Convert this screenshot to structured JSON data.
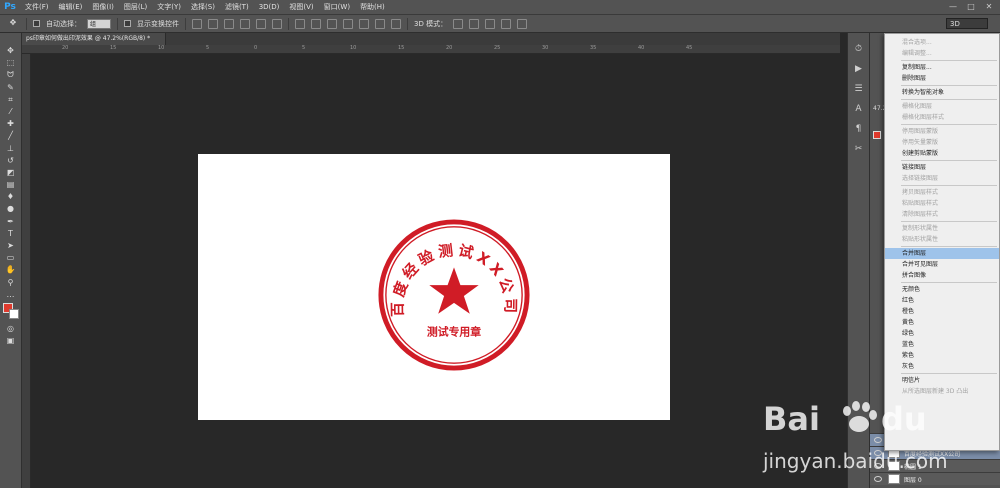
{
  "app": {
    "logo": "Ps"
  },
  "menubar": {
    "items": [
      "文件(F)",
      "编辑(E)",
      "图像(I)",
      "图层(L)",
      "文字(Y)",
      "选择(S)",
      "滤镜(T)",
      "3D(D)",
      "视图(V)",
      "窗口(W)",
      "帮助(H)"
    ],
    "window_buttons": [
      "—",
      "□",
      "✕"
    ]
  },
  "optionsbar": {
    "auto_select_label": "自动选择：",
    "auto_select_value": "组",
    "show_transform_label": "显示变换控件",
    "mode_3d_label": "3D 模式：",
    "workspace": "3D"
  },
  "document": {
    "tab_title": "ps印章如何做出印泥效果 @ 47.2%(RGB/8) *"
  },
  "ruler": {
    "top_ticks": [
      "20",
      "15",
      "10",
      "5",
      "0",
      "5",
      "10",
      "15",
      "20",
      "25",
      "30",
      "35",
      "40",
      "45"
    ]
  },
  "seal": {
    "arc_text": "百度经验测试XX公司",
    "bottom_text": "测试专用章",
    "color": "#d01c26"
  },
  "panels": {
    "zoom_readout": "47.24",
    "layers": [
      {
        "name": "★"
      },
      {
        "name": "百度经验测试XX公司"
      },
      {
        "name": "椭圆 1"
      },
      {
        "name": "图层 0"
      }
    ]
  },
  "context_menu": {
    "items": [
      {
        "label": "混合选项...",
        "enabled": false,
        "sep_after": false
      },
      {
        "label": "编辑调整...",
        "enabled": false,
        "sep_after": true
      },
      {
        "label": "复制图层...",
        "enabled": true,
        "sep_after": false
      },
      {
        "label": "删除图层",
        "enabled": true,
        "sep_after": true
      },
      {
        "label": "转换为智能对象",
        "enabled": true,
        "sep_after": true
      },
      {
        "label": "栅格化图层",
        "enabled": false,
        "sep_after": false
      },
      {
        "label": "栅格化图层样式",
        "enabled": false,
        "sep_after": true
      },
      {
        "label": "停用图层蒙版",
        "enabled": false,
        "sep_after": false
      },
      {
        "label": "停用矢量蒙版",
        "enabled": false,
        "sep_after": false
      },
      {
        "label": "创建剪贴蒙版",
        "enabled": true,
        "sep_after": true
      },
      {
        "label": "链接图层",
        "enabled": true,
        "sep_after": false
      },
      {
        "label": "选择链接图层",
        "enabled": false,
        "sep_after": true
      },
      {
        "label": "拷贝图层样式",
        "enabled": false,
        "sep_after": false
      },
      {
        "label": "粘贴图层样式",
        "enabled": false,
        "sep_after": false
      },
      {
        "label": "清除图层样式",
        "enabled": false,
        "sep_after": true
      },
      {
        "label": "复制形状属性",
        "enabled": false,
        "sep_after": false
      },
      {
        "label": "粘贴形状属性",
        "enabled": false,
        "sep_after": true
      },
      {
        "label": "合并图层",
        "enabled": true,
        "sep_after": false
      },
      {
        "label": "合并可见图层",
        "enabled": true,
        "sep_after": false
      },
      {
        "label": "拼合图像",
        "enabled": true,
        "sep_after": true
      },
      {
        "label": "无颜色",
        "enabled": true,
        "sep_after": false
      },
      {
        "label": "红色",
        "enabled": true,
        "sep_after": false
      },
      {
        "label": "橙色",
        "enabled": true,
        "sep_after": false
      },
      {
        "label": "黄色",
        "enabled": true,
        "sep_after": false
      },
      {
        "label": "绿色",
        "enabled": true,
        "sep_after": false
      },
      {
        "label": "蓝色",
        "enabled": true,
        "sep_after": false
      },
      {
        "label": "紫色",
        "enabled": true,
        "sep_after": false
      },
      {
        "label": "灰色",
        "enabled": true,
        "sep_after": true
      },
      {
        "label": "明信片",
        "enabled": true,
        "sep_after": false
      },
      {
        "label": "从所选图层新建 3D 凸出",
        "enabled": false,
        "sep_after": false
      }
    ],
    "highlighted": "合并图层"
  },
  "watermark": {
    "brand": "Bai du",
    "url": "jingyan.baidu.com"
  }
}
